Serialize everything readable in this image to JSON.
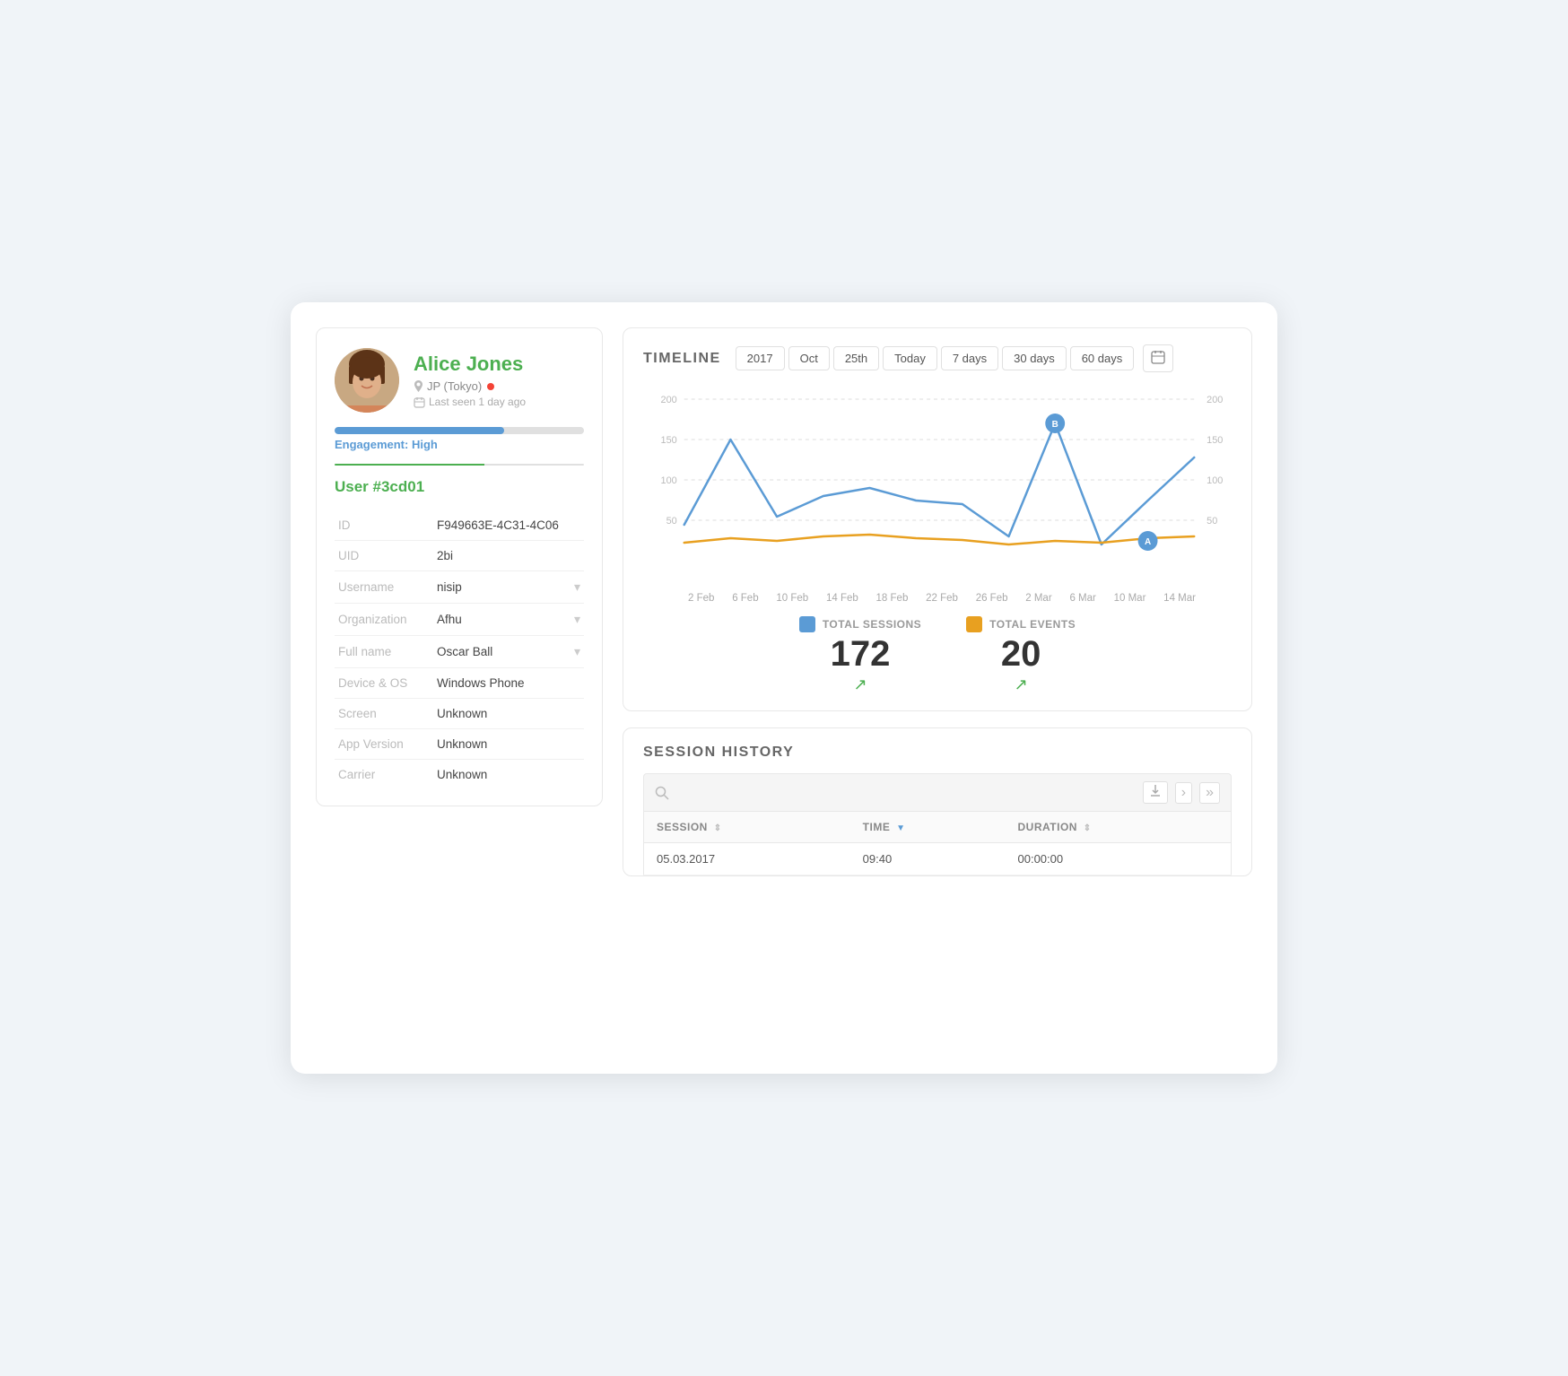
{
  "profile": {
    "name": "Alice Jones",
    "location": "JP (Tokyo)",
    "last_seen": "Last seen 1 day ago",
    "engagement_label": "Engagement:",
    "engagement_level": "High",
    "engagement_percent": 68,
    "user_id": "User #3cd01"
  },
  "fields": [
    {
      "label": "ID",
      "value": "F949663E-4C31-4C06",
      "has_arrow": false
    },
    {
      "label": "UID",
      "value": "2bi",
      "has_arrow": false
    },
    {
      "label": "Username",
      "value": "nisip",
      "has_arrow": true
    },
    {
      "label": "Organization",
      "value": "Afhu",
      "has_arrow": true
    },
    {
      "label": "Full name",
      "value": "Oscar Ball",
      "has_arrow": true
    },
    {
      "label": "Device & OS",
      "value": "Windows Phone",
      "has_arrow": false
    },
    {
      "label": "Screen",
      "value": "Unknown",
      "has_arrow": false
    },
    {
      "label": "App Version",
      "value": "Unknown",
      "has_arrow": false
    },
    {
      "label": "Carrier",
      "value": "Unknown",
      "has_arrow": false
    }
  ],
  "timeline": {
    "title": "TIMELINE",
    "filters": [
      "2017",
      "Oct",
      "25th",
      "Today",
      "7 days",
      "30 days",
      "60 days"
    ],
    "x_labels": [
      "2 Feb",
      "6 Feb",
      "10 Feb",
      "14 Feb",
      "18 Feb",
      "22 Feb",
      "26 Feb",
      "2 Mar",
      "6 Mar",
      "10 Mar",
      "14 Mar"
    ],
    "y_labels_left": [
      "200",
      "150",
      "100",
      "50"
    ],
    "y_labels_right": [
      "200",
      "150",
      "100",
      "50"
    ],
    "sessions_label": "TOTAL SESSIONS",
    "sessions_value": "172",
    "events_label": "TOTAL EVENTS",
    "events_value": "20",
    "legend_sessions_color": "#5b9bd5",
    "legend_events_color": "#e8a020",
    "chart": {
      "sessions": [
        45,
        150,
        55,
        80,
        90,
        75,
        70,
        30,
        170,
        20,
        75,
        130
      ],
      "events": [
        22,
        28,
        25,
        30,
        32,
        28,
        26,
        20,
        25,
        22,
        28,
        30
      ]
    }
  },
  "session_history": {
    "title": "SESSION HISTORY",
    "search_placeholder": "Search...",
    "columns": [
      "SESSION",
      "TIME",
      "DURATION"
    ],
    "rows": [
      {
        "session": "05.03.2017",
        "time": "09:40",
        "duration": "00:00:00"
      }
    ],
    "toolbar_icons": {
      "download": "⬇",
      "next": "›",
      "last": "»"
    }
  },
  "colors": {
    "green": "#4caf50",
    "blue": "#5b9bd5",
    "orange": "#e8a020",
    "light_border": "#e8e8e8"
  }
}
